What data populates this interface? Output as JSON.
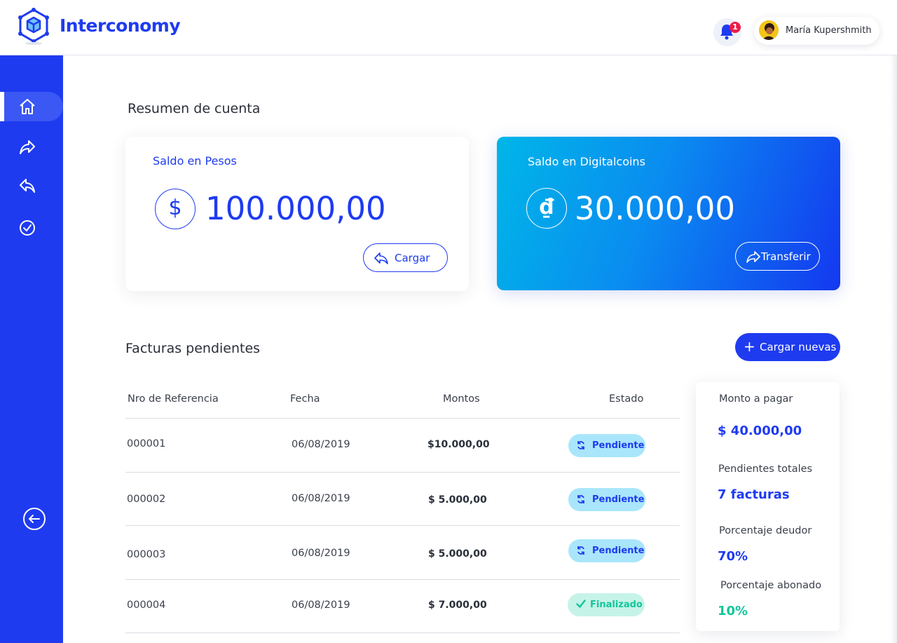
{
  "header": {
    "brand": "Interconomy",
    "notifications_count": "1",
    "user_name": "María Kupershmith"
  },
  "sidebar": {
    "items": [
      {
        "icon": "home-icon",
        "active": true
      },
      {
        "icon": "send-arrow-icon",
        "active": false
      },
      {
        "icon": "reply-arrow-icon",
        "active": false
      },
      {
        "icon": "check-circle-icon",
        "active": false
      }
    ],
    "logout_icon": "back-arrow-circle-icon"
  },
  "summary_section": {
    "title": "Resumen de cuenta",
    "pesos": {
      "label": "Saldo en Pesos",
      "symbol": "$",
      "amount": "100.000,00",
      "button": "Cargar"
    },
    "digitalcoins": {
      "label": "Saldo en Digitalcoins",
      "symbol": "₫",
      "amount": "30.000,00",
      "button": "Transferir"
    }
  },
  "invoices": {
    "title": "Facturas pendientes",
    "add_button": "Cargar nuevas",
    "columns": [
      "Nro de Referencia",
      "Fecha",
      "Montos",
      "Estado"
    ],
    "rows": [
      {
        "ref": "000001",
        "date": "06/08/2019",
        "amount": "$10.000,00",
        "status": "Pendiente"
      },
      {
        "ref": "000002",
        "date": "06/08/2019",
        "amount": "$ 5.000,00",
        "status": "Pendiente"
      },
      {
        "ref": "000003",
        "date": "06/08/2019",
        "amount": "$ 5.000,00",
        "status": "Pendiente"
      },
      {
        "ref": "000004",
        "date": "06/08/2019",
        "amount": "$ 7.000,00",
        "status": "Finalizado"
      }
    ]
  },
  "stats": {
    "monto_label": "Monto a pagar",
    "monto_value": "$ 40.000,00",
    "pendientes_label": "Pendientes totales",
    "pendientes_value": "7 facturas",
    "deudor_label": "Porcentaje deudor",
    "deudor_value": "70%",
    "abonado_label": "Porcentaje abonado",
    "abonado_value": "10%"
  },
  "colors": {
    "primary": "#1e3bf0",
    "pending_bg": "#a9e6fb",
    "done_bg": "#c6f3e8",
    "done_text": "#12c69a"
  }
}
